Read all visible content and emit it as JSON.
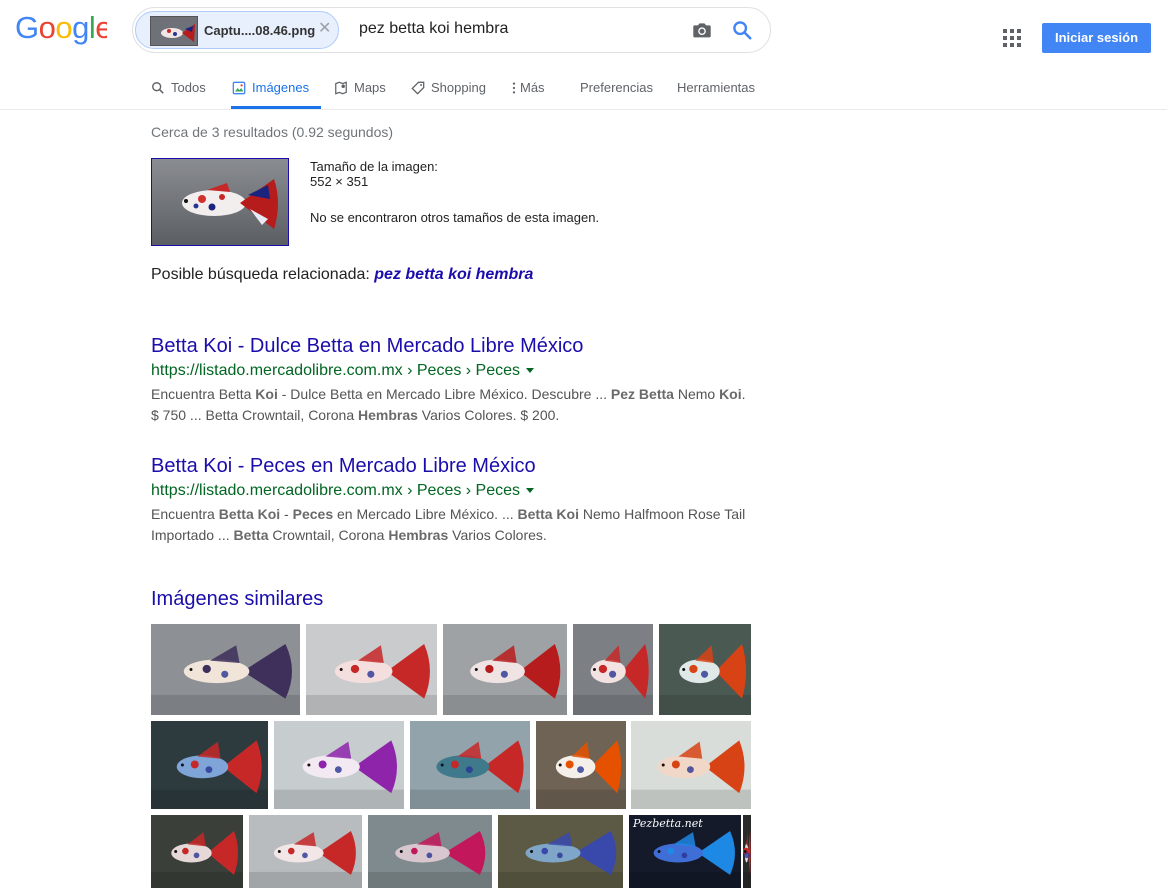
{
  "logo": {
    "text": "Google",
    "letters": [
      {
        "ch": "G",
        "color": "#4285f4"
      },
      {
        "ch": "o",
        "color": "#ea4335"
      },
      {
        "ch": "o",
        "color": "#fbbc05"
      },
      {
        "ch": "g",
        "color": "#4285f4"
      },
      {
        "ch": "l",
        "color": "#34a853"
      },
      {
        "ch": "e",
        "color": "#ea4335"
      }
    ]
  },
  "search": {
    "image_chip_label": "Captu....08.46.png",
    "query": "pez betta koi hembra"
  },
  "header": {
    "signin_label": "Iniciar sesión"
  },
  "tabs": [
    {
      "label": "Todos",
      "icon": "search-icon"
    },
    {
      "label": "Imágenes",
      "icon": "image-icon",
      "active": true
    },
    {
      "label": "Maps",
      "icon": "map-icon"
    },
    {
      "label": "Shopping",
      "icon": "tag-icon"
    },
    {
      "label": "Más",
      "icon": "more-vert-icon"
    },
    {
      "label": "Preferencias"
    },
    {
      "label": "Herramientas"
    }
  ],
  "stats": "Cerca de 3 resultados (0.92 segundos)",
  "image_info": {
    "size_label": "Tamaño de la imagen:",
    "size_value": "552 × 351",
    "no_other_sizes": "No se encontraron otros tamaños de esta imagen."
  },
  "related": {
    "prefix": "Posible búsqueda relacionada: ",
    "query": "pez betta koi hembra"
  },
  "results": [
    {
      "title": "Betta Koi - Dulce Betta en Mercado Libre México",
      "url": "https://listado.mercadolibre.com.mx › Peces › Peces",
      "snippet_line1": "Encuentra Betta <b>Koi</b> - Dulce Betta en Mercado Libre México. Descubre ... <b>Pez Betta</b> Nemo <b>Koi</b>.",
      "snippet_line2": "$ 750 ... Betta Crowntail, Corona <b>Hembras</b> Varios Colores. $ 200."
    },
    {
      "title": "Betta Koi - Peces en Mercado Libre México",
      "url": "https://listado.mercadolibre.com.mx › Peces › Peces",
      "snippet_line1": "Encuentra <b>Betta Koi</b> - <b>Peces</b> en Mercado Libre México. ... <b>Betta Koi</b> Nemo Halfmoon Rose Tail",
      "snippet_line2": "Importado ... <b>Betta</b> Crowntail, Corona <b>Hembras</b> Varios Colores."
    }
  ],
  "similar": {
    "title": "Imágenes similares",
    "watermark": "Pezbetta.net"
  },
  "colors": {
    "link": "#1a0dab",
    "url": "#006621",
    "accent": "#1a73e8",
    "signin": "#4285f4"
  }
}
